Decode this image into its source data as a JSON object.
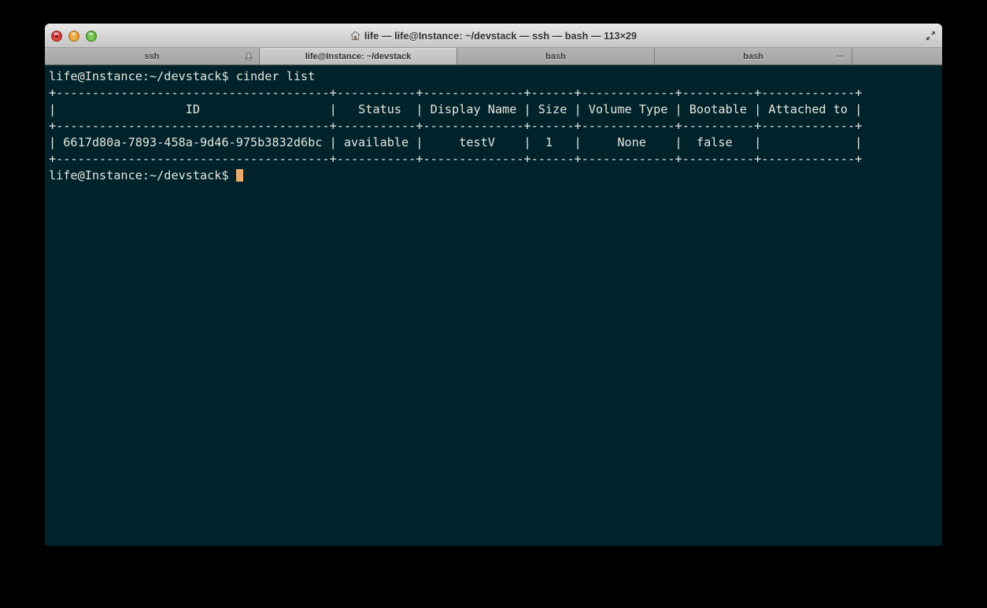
{
  "window": {
    "title": "life — life@Instance: ~/devstack — ssh — bash — 113×29",
    "title_icon": "home-icon",
    "controls": {
      "close": "close",
      "minimize": "minimize",
      "zoom": "zoom",
      "fullscreen": "fullscreen"
    }
  },
  "tabs": [
    {
      "label": "ssh",
      "selected": false,
      "icon": "bell-icon"
    },
    {
      "label": "life@Instance: ~/devstack",
      "selected": true,
      "icon": ""
    },
    {
      "label": "bash",
      "selected": false,
      "icon": ""
    },
    {
      "label": "bash",
      "selected": false,
      "icon": "ellipsis-icon"
    }
  ],
  "terminal": {
    "columns": 113,
    "rows": 29,
    "background_color": "#00222b",
    "foreground_color": "#e6e6dc",
    "cursor_color": "#e9a96c",
    "prompt": "life@Instance:~/devstack$",
    "command": "cinder list",
    "separator": "+----------------------------------------+------------+--------------+------+-------------+----------+-------------+",
    "table": {
      "headers": [
        "ID",
        "Status",
        "Display Name",
        "Size",
        "Volume Type",
        "Bootable",
        "Attached to"
      ],
      "rows": [
        [
          "6617d80a-7893-458a-9d46-975b3832d6bc",
          "available",
          "testV",
          "1",
          "None",
          "false",
          ""
        ]
      ]
    },
    "output_lines": [
      "life@Instance:~/devstack$ cinder list",
      "+--------------------------------------+-----------+--------------+------+-------------+----------+-------------+",
      "|                  ID                  |   Status  | Display Name | Size | Volume Type | Bootable | Attached to |",
      "+--------------------------------------+-----------+--------------+------+-------------+----------+-------------+",
      "| 6617d80a-7893-458a-9d46-975b3832d6bc | available |     testV    |  1   |     None    |  false   |             |",
      "+--------------------------------------+-----------+--------------+------+-------------+----------+-------------+",
      "life@Instance:~/devstack$ "
    ]
  }
}
